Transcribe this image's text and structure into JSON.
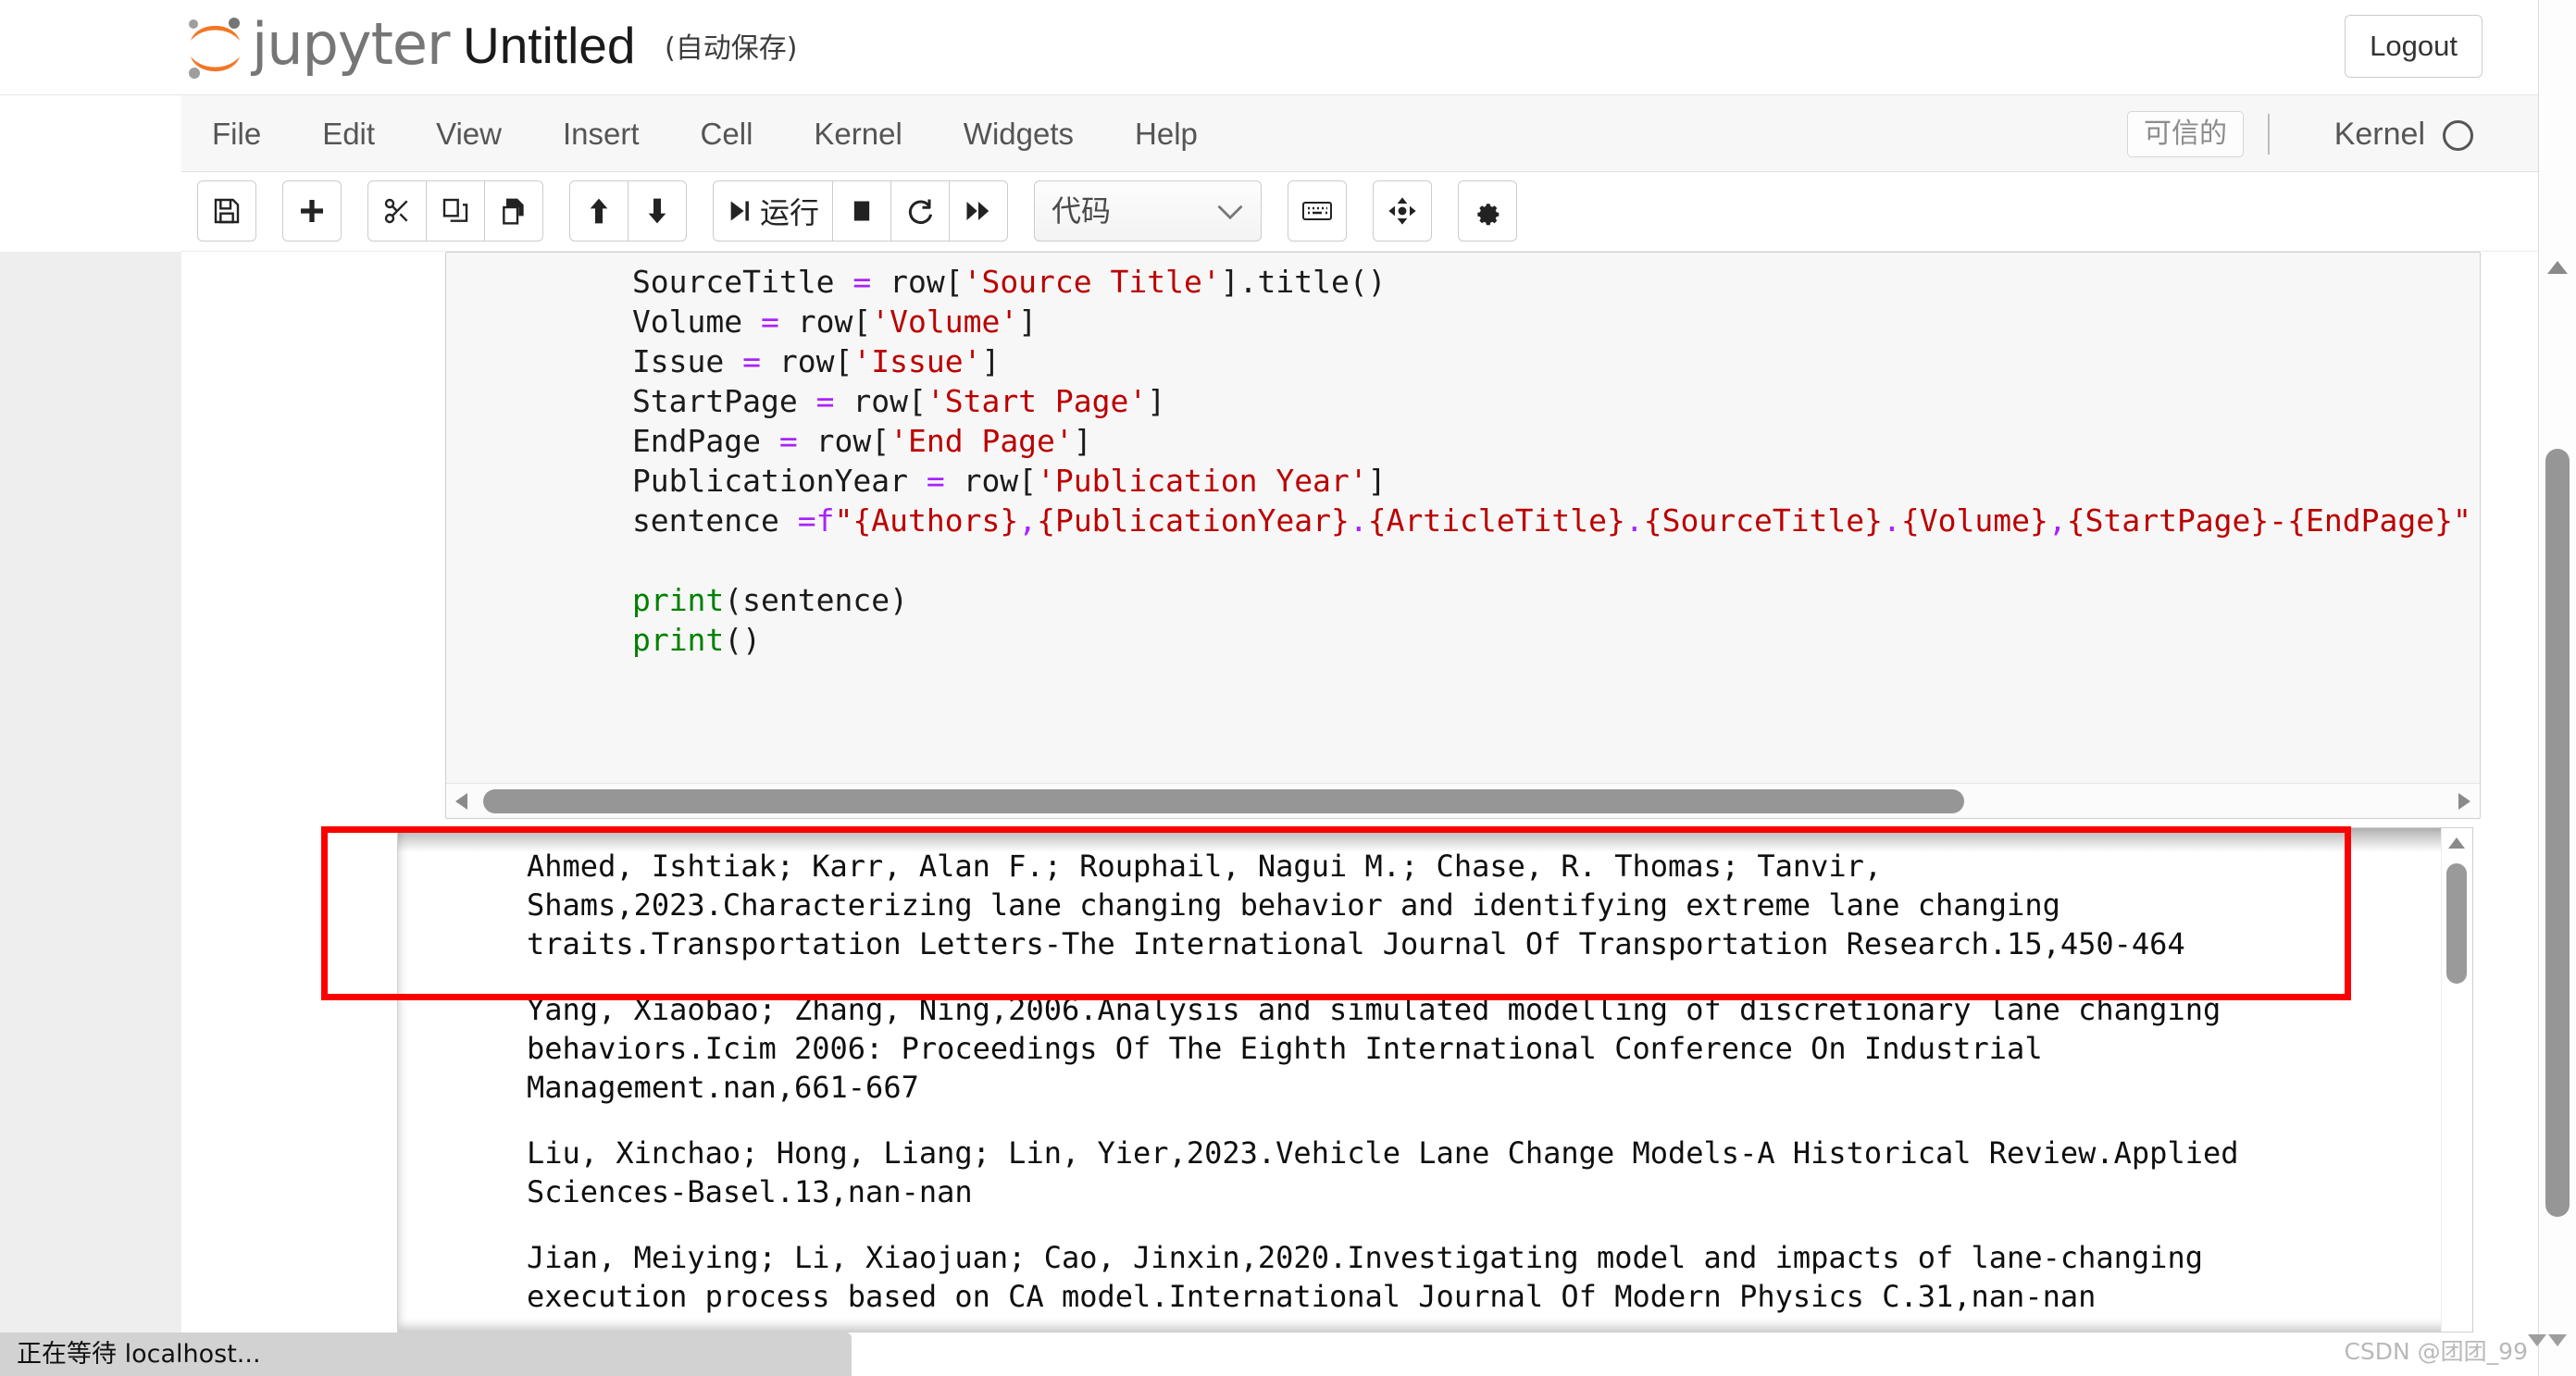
{
  "header": {
    "brand": "jupyter",
    "notebook_title": "Untitled",
    "autosave_label": "(自动保存)",
    "logout_label": "Logout",
    "logo_icon": "jupyter-logo-icon"
  },
  "menubar": {
    "items": [
      {
        "label": "File"
      },
      {
        "label": "Edit"
      },
      {
        "label": "View"
      },
      {
        "label": "Insert"
      },
      {
        "label": "Cell"
      },
      {
        "label": "Kernel"
      },
      {
        "label": "Widgets"
      },
      {
        "label": "Help"
      }
    ],
    "trusted_label": "可信的",
    "kernel_label": "Kernel",
    "kernel_status_icon": "kernel-idle-circle-icon"
  },
  "toolbar": {
    "buttons": [
      {
        "name": "save-button",
        "icon": "floppy-disk-icon",
        "label": ""
      },
      {
        "name": "insert-cell-below-button",
        "icon": "plus-icon",
        "label": ""
      },
      {
        "name": "cut-cell-button",
        "icon": "scissors-icon",
        "label": ""
      },
      {
        "name": "copy-cell-button",
        "icon": "copy-icon",
        "label": ""
      },
      {
        "name": "paste-cell-button",
        "icon": "paste-icon",
        "label": ""
      },
      {
        "name": "move-cell-up-button",
        "icon": "arrow-up-icon",
        "label": ""
      },
      {
        "name": "move-cell-down-button",
        "icon": "arrow-down-icon",
        "label": ""
      },
      {
        "name": "run-cell-button",
        "icon": "run-icon",
        "label": "运行"
      },
      {
        "name": "interrupt-kernel-button",
        "icon": "stop-square-icon",
        "label": ""
      },
      {
        "name": "restart-kernel-button",
        "icon": "restart-circle-icon",
        "label": ""
      },
      {
        "name": "restart-and-run-all-button",
        "icon": "fast-forward-icon",
        "label": ""
      },
      {
        "name": "open-command-palette-button",
        "icon": "keyboard-icon",
        "label": ""
      },
      {
        "name": "toggle-cell-toolbar-button",
        "icon": "crosshair-move-icon",
        "label": ""
      },
      {
        "name": "nbextensions-button",
        "icon": "gear-icon",
        "label": ""
      }
    ],
    "cell_type_select": {
      "value": "代码",
      "chevron_icon": "chevron-down-icon"
    }
  },
  "notebook": {
    "code_cell": {
      "lines": [
        {
          "segments": [
            {
              "t": "        SourceTitle ",
              "c": ""
            },
            {
              "t": "=",
              "c": "tok-op"
            },
            {
              "t": " row[",
              "c": ""
            },
            {
              "t": "'Source Title'",
              "c": "tok-str"
            },
            {
              "t": "].title()",
              "c": ""
            }
          ]
        },
        {
          "segments": [
            {
              "t": "        Volume ",
              "c": ""
            },
            {
              "t": "=",
              "c": "tok-op"
            },
            {
              "t": " row[",
              "c": ""
            },
            {
              "t": "'Volume'",
              "c": "tok-str"
            },
            {
              "t": "]",
              "c": ""
            }
          ]
        },
        {
          "segments": [
            {
              "t": "        Issue ",
              "c": ""
            },
            {
              "t": "=",
              "c": "tok-op"
            },
            {
              "t": " row[",
              "c": ""
            },
            {
              "t": "'Issue'",
              "c": "tok-str"
            },
            {
              "t": "]",
              "c": ""
            }
          ]
        },
        {
          "segments": [
            {
              "t": "        StartPage ",
              "c": ""
            },
            {
              "t": "=",
              "c": "tok-op"
            },
            {
              "t": " row[",
              "c": ""
            },
            {
              "t": "'Start Page'",
              "c": "tok-str"
            },
            {
              "t": "]",
              "c": ""
            }
          ]
        },
        {
          "segments": [
            {
              "t": "        EndPage ",
              "c": ""
            },
            {
              "t": "=",
              "c": "tok-op"
            },
            {
              "t": " row[",
              "c": ""
            },
            {
              "t": "'End Page'",
              "c": "tok-str"
            },
            {
              "t": "]",
              "c": ""
            }
          ]
        },
        {
          "segments": [
            {
              "t": "        PublicationYear ",
              "c": ""
            },
            {
              "t": "=",
              "c": "tok-op"
            },
            {
              "t": " row[",
              "c": ""
            },
            {
              "t": "'Publication Year'",
              "c": "tok-str"
            },
            {
              "t": "]",
              "c": ""
            }
          ]
        },
        {
          "segments": [
            {
              "t": "        sentence ",
              "c": ""
            },
            {
              "t": "=f",
              "c": "tok-op"
            },
            {
              "t": "\"{Authors}",
              "c": "tok-str"
            },
            {
              "t": ",",
              "c": "tok-op"
            },
            {
              "t": "{PublicationYear}",
              "c": "tok-str"
            },
            {
              "t": ".",
              "c": "tok-op"
            },
            {
              "t": "{ArticleTitle}",
              "c": "tok-str"
            },
            {
              "t": ".",
              "c": "tok-op"
            },
            {
              "t": "{SourceTitle}",
              "c": "tok-str"
            },
            {
              "t": ".",
              "c": "tok-op"
            },
            {
              "t": "{Volume}",
              "c": "tok-str"
            },
            {
              "t": ",",
              "c": "tok-op"
            },
            {
              "t": "{StartPage}-{EndPage}\"",
              "c": "tok-str"
            }
          ]
        },
        {
          "segments": [
            {
              "t": "",
              "c": ""
            }
          ]
        },
        {
          "segments": [
            {
              "t": "        ",
              "c": ""
            },
            {
              "t": "print",
              "c": "tok-fn"
            },
            {
              "t": "(sentence)",
              "c": ""
            }
          ]
        },
        {
          "segments": [
            {
              "t": "        ",
              "c": ""
            },
            {
              "t": "print",
              "c": "tok-fn"
            },
            {
              "t": "()",
              "c": ""
            }
          ]
        }
      ],
      "hscrollbar": {
        "left_arrow_icon": "triangle-left-icon",
        "right_arrow_icon": "triangle-right-icon"
      }
    },
    "output": {
      "citations": [
        "Ahmed, Ishtiak; Karr, Alan F.; Rouphail, Nagui M.; Chase, R. Thomas; Tanvir, Shams,2023.Characterizing lane changing behavior and identifying extreme lane changing traits.Transportation Letters-The International Journal Of Transportation Research.15,450-464",
        "Yang, Xiaobao; Zhang, Ning,2006.Analysis and simulated modelling of discretionary lane changing behaviors.Icim 2006: Proceedings Of The Eighth International Conference On Industrial Management.nan,661-667",
        "Liu, Xinchao; Hong, Liang; Lin, Yier,2023.Vehicle Lane Change Models-A Historical Review.Applied Sciences-Basel.13,nan-nan",
        "Jian, Meiying; Li, Xiaojuan; Cao, Jinxin,2020.Investigating model and impacts of lane-changing execution process based on CA model.International Journal Of Modern Physics C.31,nan-nan"
      ],
      "vscrollbar": {
        "up_arrow_icon": "triangle-up-icon"
      }
    },
    "annotation": {
      "name": "red-highlight-rectangle",
      "color": "#fb0000"
    }
  },
  "browser": {
    "scrollbar": {
      "up_arrow_icon": "triangle-up-icon"
    },
    "status_text": "正在等待 localhost..."
  },
  "watermark": {
    "text": "CSDN @团团_99"
  },
  "colors": {
    "jupyter_orange": "#f37726",
    "annotation_red": "#fb0000",
    "string_red": "#bb0000",
    "operator_purple": "#aa22ff",
    "function_green": "#008000"
  }
}
